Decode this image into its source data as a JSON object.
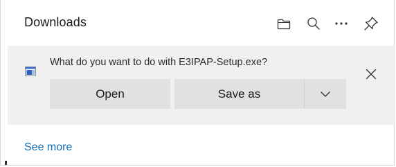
{
  "header": {
    "title": "Downloads",
    "icons": [
      "folder-icon",
      "search-icon",
      "more-icon",
      "pin-icon"
    ]
  },
  "prompt": {
    "file_icon": "exe-file-icon",
    "question": "What do you want to do with E3IPAP-Setup.exe?",
    "open_label": "Open",
    "save_as_label": "Save as",
    "dropdown_icon": "chevron-down-icon",
    "close_icon": "close-icon"
  },
  "footer": {
    "see_more_label": "See more"
  },
  "colors": {
    "accent": "#0f6cbd",
    "prompt_bg": "#f0f0f0",
    "button_bg": "#e1e1e1"
  }
}
